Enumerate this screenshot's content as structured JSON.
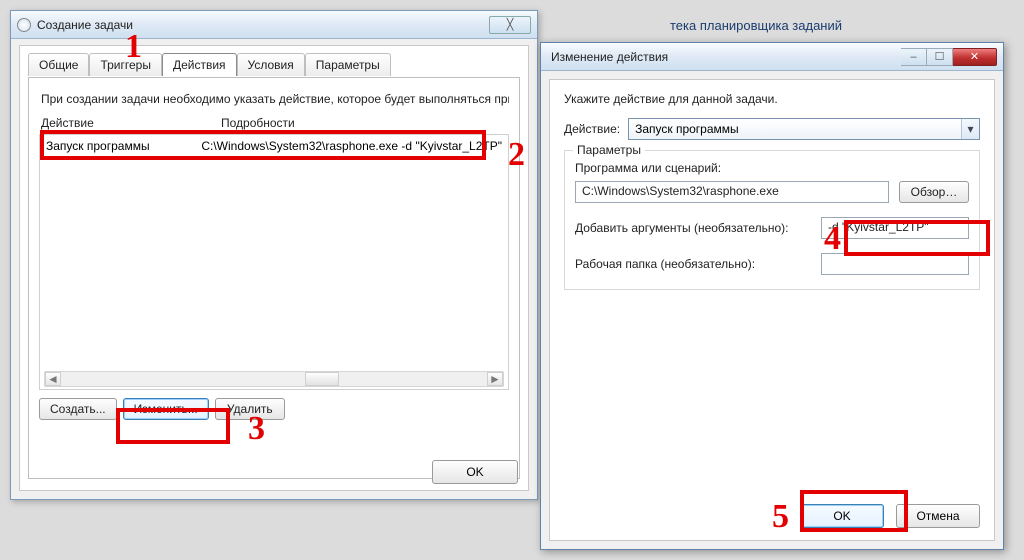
{
  "bg": {
    "scheduler": "тека планировщика заданий"
  },
  "win1": {
    "title": "Создание задачи",
    "close_x": "╳",
    "tabs": [
      "Общие",
      "Триггеры",
      "Действия",
      "Условия",
      "Параметры"
    ],
    "active_tab": 2,
    "desc": "При создании задачи необходимо указать действие, которое будет выполняться при ее з…",
    "columns": [
      "Действие",
      "Подробности"
    ],
    "row": {
      "action": "Запуск программы",
      "details": "C:\\Windows\\System32\\rasphone.exe -d \"Kyivstar_L2TP\""
    },
    "buttons": {
      "create": "Создать...",
      "edit": "Изменить...",
      "delete": "Удалить"
    },
    "ok": "OK"
  },
  "win2": {
    "title": "Изменение действия",
    "min": "–",
    "max": "☐",
    "close": "✕",
    "instruct": "Укажите действие для данной задачи.",
    "action_lbl": "Действие:",
    "action_val": "Запуск программы",
    "group": "Параметры",
    "program_lbl": "Программа или сценарий:",
    "program_val": "C:\\Windows\\System32\\rasphone.exe",
    "browse": "Обзор…",
    "args_lbl": "Добавить аргументы (необязательно):",
    "args_val": "-d \"Kyivstar_L2TP\"",
    "startin_lbl": "Рабочая папка (необязательно):",
    "startin_val": "",
    "ok": "OK",
    "cancel": "Отмена"
  },
  "anno": {
    "1": "1",
    "2": "2",
    "3": "3",
    "4": "4",
    "5": "5"
  }
}
